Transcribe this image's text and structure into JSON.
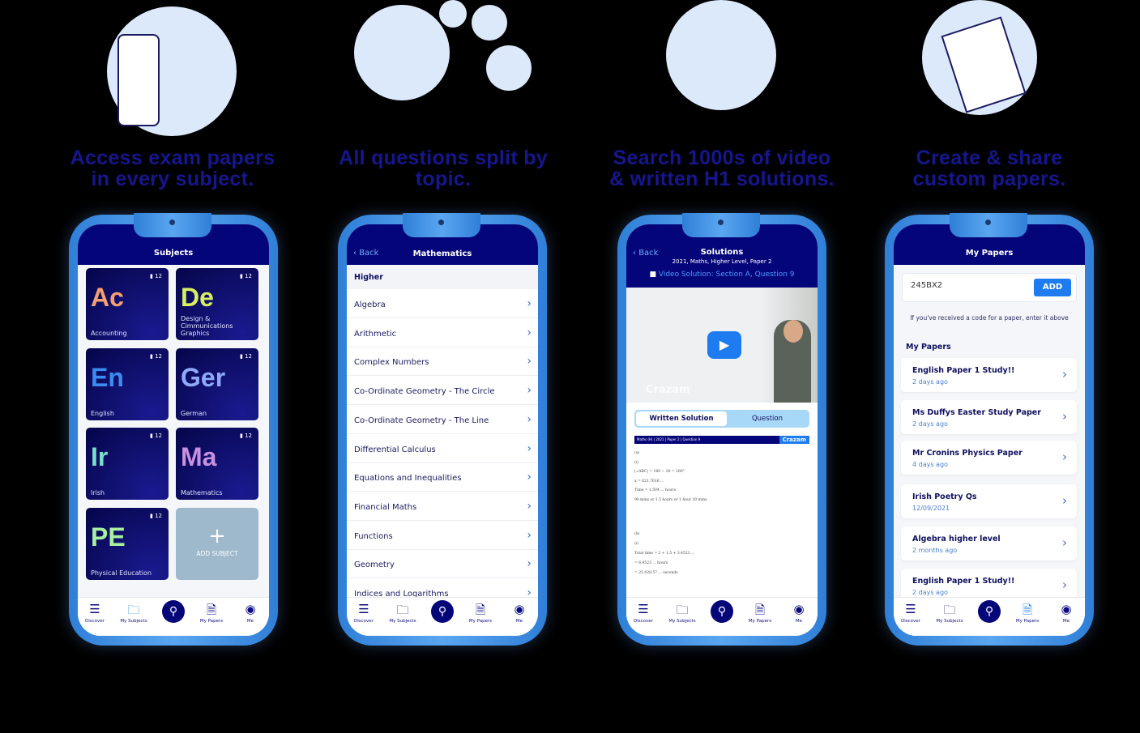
{
  "headings": [
    {
      "l1": "Access exam papers",
      "l2": "in every subject."
    },
    {
      "l1": "All questions split by",
      "l2": "topic."
    },
    {
      "l1": "Search 1000s of video",
      "l2": "& written H1 solutions."
    },
    {
      "l1": "Create & share",
      "l2": "custom papers."
    }
  ],
  "nav": {
    "items": [
      "Discover",
      "My Subjects",
      "My Papers",
      "Me"
    ]
  },
  "subjects": {
    "title": "Subjects",
    "tiles": [
      {
        "abbr": "Ac",
        "name": "Accounting",
        "count": "12",
        "color": "#f3a070"
      },
      {
        "abbr": "De",
        "name": "Design & Cimmunications Graphics",
        "count": "12",
        "color": "#d6f060"
      },
      {
        "abbr": "En",
        "name": "English",
        "count": "12",
        "color": "#3a8cf0"
      },
      {
        "abbr": "Ger",
        "name": "German",
        "count": "12",
        "color": "#8fa8f8"
      },
      {
        "abbr": "Ir",
        "name": "Irish",
        "count": "12",
        "color": "#7ae0c8"
      },
      {
        "abbr": "Ma",
        "name": "Mathematics",
        "count": "12",
        "color": "#c890e0"
      },
      {
        "abbr": "PE",
        "name": "Physical Education",
        "count": "12",
        "color": "#a8f0a0"
      }
    ],
    "add_label": "ADD SUBJECT"
  },
  "topics": {
    "back": "Back",
    "title": "Mathematics",
    "section": "Higher",
    "items": [
      "Algebra",
      "Arithmetic",
      "Complex Numbers",
      "Co-Ordinate Geometry - The Circle",
      "Co-Ordinate Geometry - The Line",
      "Differential Calculus",
      "Equations and Inequalities",
      "Financial Maths",
      "Functions",
      "Geometry",
      "Indices and Logarithms"
    ]
  },
  "solutions": {
    "back": "Back",
    "title": "Solutions",
    "subtitle": "2021, Maths, Higher Level, Paper 2",
    "video_label": "Video Solution: Section A, Question 9",
    "watermark": "Crazam",
    "tabs": [
      "Written Solution",
      "Question"
    ],
    "doc_header": "Maths (H) | 2021 | Paper 2 | Question 9",
    "doc_brand": "Crazam",
    "doc_lines": [
      "(a)",
      "(i)",
      "|∠ABC| = 180 − 20 = 160°",
      "x = 621.7616 ...",
      "Time = 1.504 ... hours",
      "90 mins or 1.5 hours or 1 hour 30 mins",
      "(b)",
      "(i)",
      "Total time = 2 + 1.5 + 3.4523 ...",
      "= 6.9523 ... hours",
      "= 25 028.57 ... seconds"
    ]
  },
  "papers": {
    "title": "My Papers",
    "code_value": "245BX2",
    "add_label": "ADD",
    "hint": "If you've received a code for a paper, enter it above",
    "section": "My Papers",
    "items": [
      {
        "name": "English Paper 1 Study!!",
        "date": "2 days ago"
      },
      {
        "name": "Ms Duffys Easter Study Paper",
        "date": "2 days ago"
      },
      {
        "name": "Mr Cronins Physics Paper",
        "date": "4 days ago"
      },
      {
        "name": "Irish Poetry Qs",
        "date": "12/09/2021"
      },
      {
        "name": "Algebra higher level",
        "date": "2 months ago"
      },
      {
        "name": "English Paper 1 Study!!",
        "date": "2 days ago"
      }
    ]
  },
  "colors": {
    "navy": "#05057a",
    "accent": "#1e7cf0",
    "heading": "#1a1aa8"
  }
}
